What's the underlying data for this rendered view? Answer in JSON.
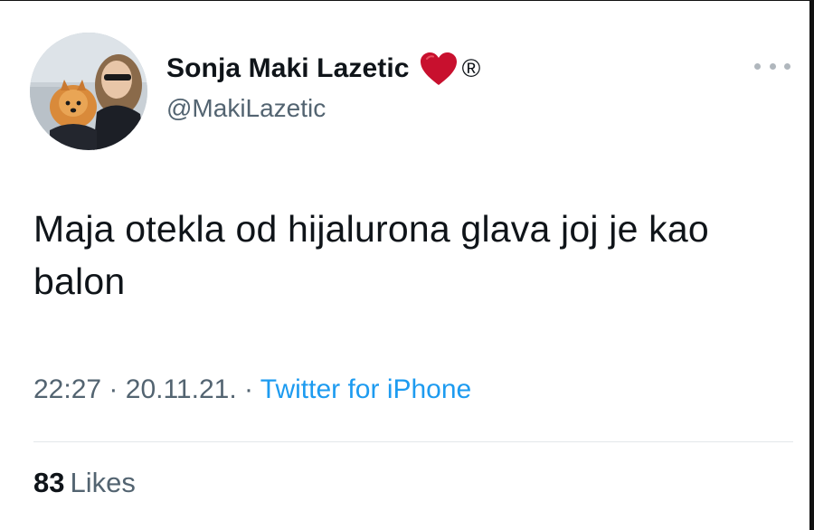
{
  "tweet": {
    "author": {
      "display_name": "Sonja Maki Lazetic",
      "registered_mark": "®",
      "handle": "@MakiLazetic",
      "avatar_icon": "profile-photo-woman-with-pomeranian-dog",
      "heart_icon": "red-heart-emoji",
      "heart_color": "#c8102e"
    },
    "more_icon": "ellipsis-icon",
    "text": "Maja otekla od hijalurona glava joj je kao balon",
    "time": "22:27",
    "date": "20.11.21.",
    "separator": "·",
    "source": "Twitter for iPhone",
    "likes": {
      "count": "83",
      "label": "Likes"
    }
  },
  "colors": {
    "text_primary": "#0f1419",
    "text_secondary": "#536471",
    "link": "#1d9bf0",
    "divider": "#e3e7ea"
  }
}
